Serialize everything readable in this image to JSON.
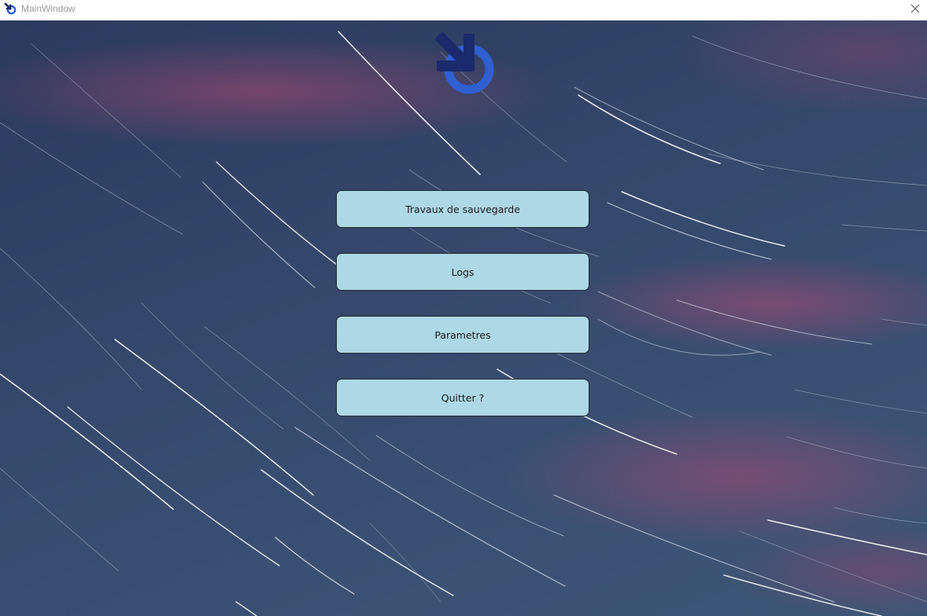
{
  "window": {
    "title": "MainWindow",
    "app_icon": "app-logo-icon",
    "close_icon": "close-icon"
  },
  "main": {
    "logo": "app-logo-icon",
    "buttons": [
      {
        "label": "Travaux de sauvegarde"
      },
      {
        "label": "Logs"
      },
      {
        "label": "Parametres"
      },
      {
        "label": "Quitter ?"
      }
    ]
  },
  "colors": {
    "button_bg": "#add8e6",
    "button_border": "#222831",
    "logo_dark": "#1a2a6c",
    "logo_light": "#2f5fd0"
  }
}
